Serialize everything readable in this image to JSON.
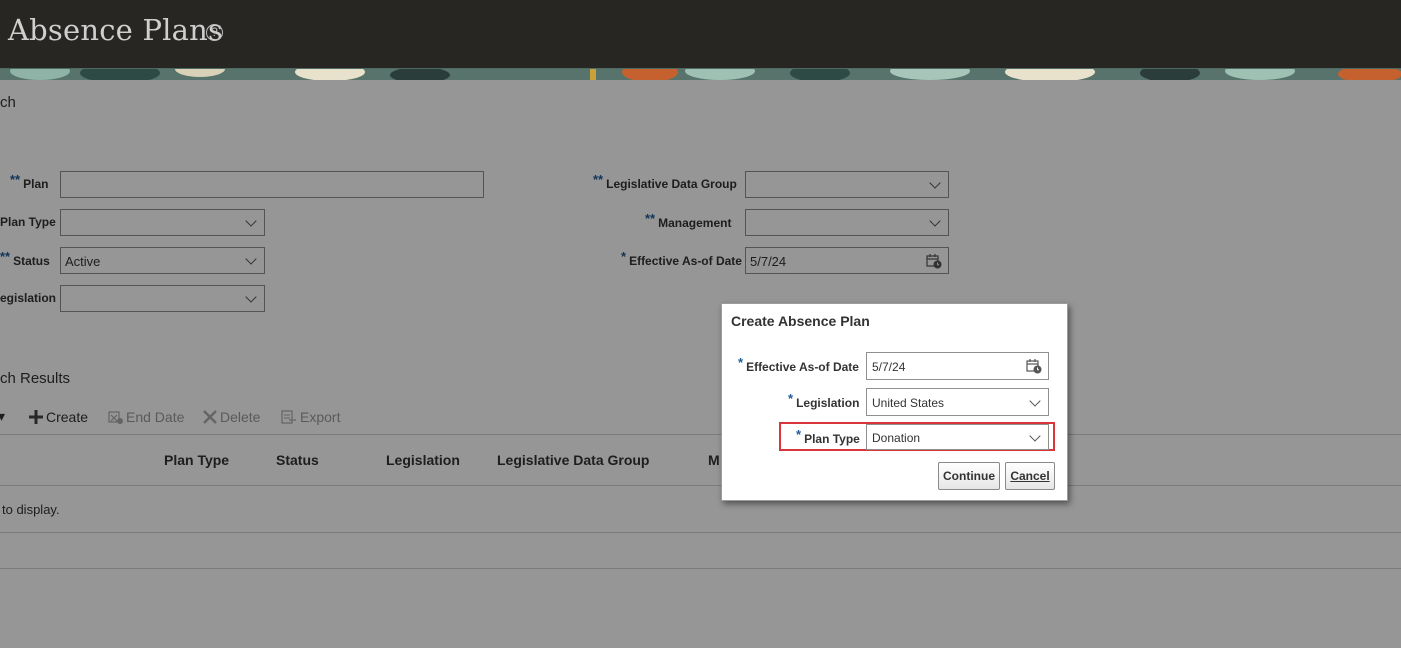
{
  "header": {
    "title": "Absence Plans",
    "help_glyph": "?"
  },
  "search": {
    "section_title": "ch",
    "required_mark_double": "**",
    "required_mark_single": "*",
    "fields": {
      "plan": {
        "label": "Plan",
        "value": ""
      },
      "plan_type": {
        "label": "Plan Type",
        "value": ""
      },
      "status": {
        "label": "Status",
        "value": "Active"
      },
      "legislation": {
        "label": "egislation",
        "value": ""
      },
      "legislative_data_group": {
        "label": "Legislative Data Group",
        "value": ""
      },
      "management": {
        "label": "Management",
        "value": ""
      },
      "effective_date": {
        "label": "Effective As-of Date",
        "value": "5/7/24"
      }
    }
  },
  "results": {
    "section_title": "ch Results",
    "toolbar": {
      "create": "Create",
      "end_date": "End Date",
      "delete": "Delete",
      "export": "Export"
    },
    "columns": [
      "Plan Type",
      "Status",
      "Legislation",
      "Legislative Data Group",
      "M"
    ],
    "empty_message": "to display."
  },
  "dialog": {
    "title": "Create Absence Plan",
    "required_mark": "*",
    "effective_date": {
      "label": "Effective As-of Date",
      "value": "5/7/24"
    },
    "legislation": {
      "label": "Legislation",
      "value": "United States"
    },
    "plan_type": {
      "label": "Plan Type",
      "value": "Donation"
    },
    "continue_label": "Continue",
    "cancel_label": "Cancel"
  },
  "colors": {
    "header_bg": "#282623",
    "required_mark": "#1f5c99",
    "highlight_border": "#d9363b"
  }
}
